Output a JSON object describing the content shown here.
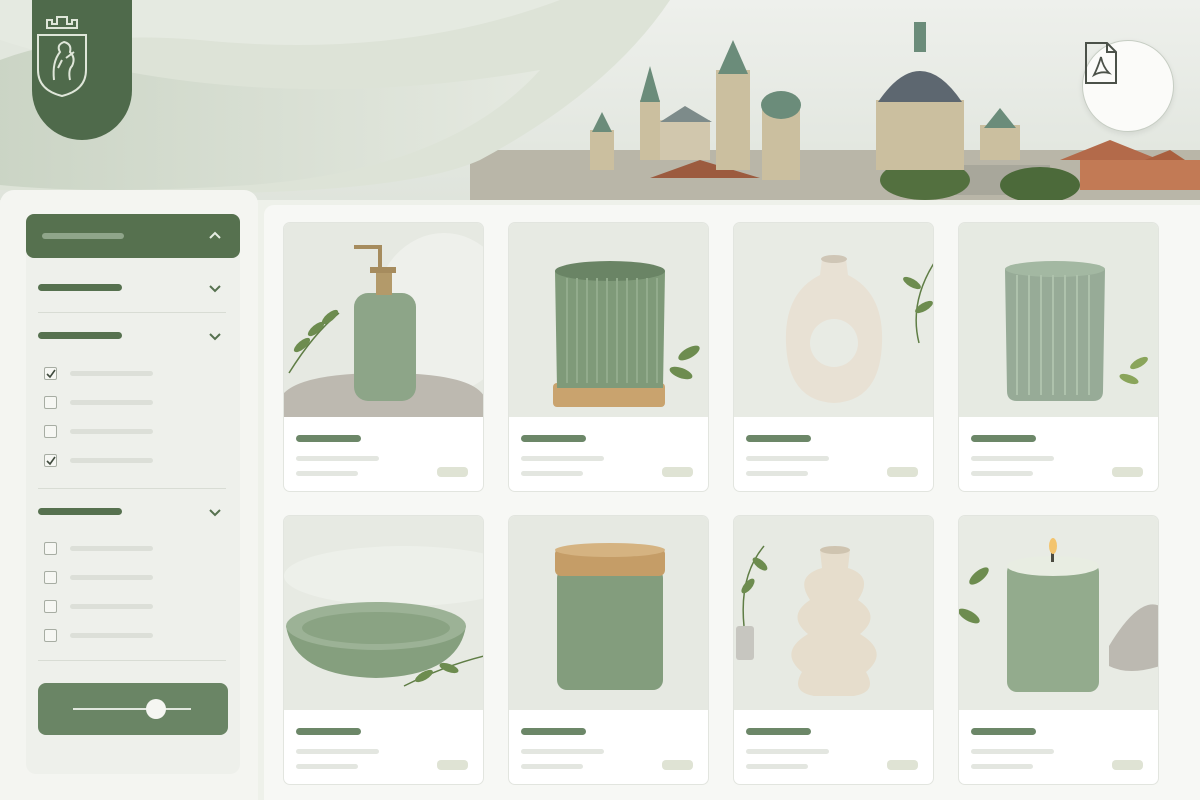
{
  "hero": {
    "background": "panorama-with-domes",
    "accent": "#4f6a4b"
  },
  "crest": {
    "icon": "lion-crest-icon"
  },
  "actions": {
    "pdf_icon": "pdf-document-icon"
  },
  "filters": {
    "header_expanded": true,
    "sections": [
      {
        "expanded": false,
        "options": []
      },
      {
        "expanded": true,
        "options": [
          {
            "checked": true
          },
          {
            "checked": false
          },
          {
            "checked": false
          },
          {
            "checked": true
          }
        ]
      },
      {
        "expanded": true,
        "options": [
          {
            "checked": false
          },
          {
            "checked": false
          },
          {
            "checked": false
          },
          {
            "checked": false
          }
        ]
      }
    ],
    "range_slider_value": 0.62
  },
  "products": [
    {
      "image": "sage-soap-dispenser"
    },
    {
      "image": "ribbed-green-pot"
    },
    {
      "image": "cream-ring-vase"
    },
    {
      "image": "green-ribbed-glass"
    },
    {
      "image": "sage-ceramic-bowl"
    },
    {
      "image": "sage-canister-bamboo-lid"
    },
    {
      "image": "cream-wavy-vase"
    },
    {
      "image": "sage-glass-candle"
    }
  ],
  "colors": {
    "primary": "#56714f",
    "text_placeholder": "#6c8768",
    "price_placeholder": "#dfe3d4",
    "background": "#eef1ea"
  }
}
